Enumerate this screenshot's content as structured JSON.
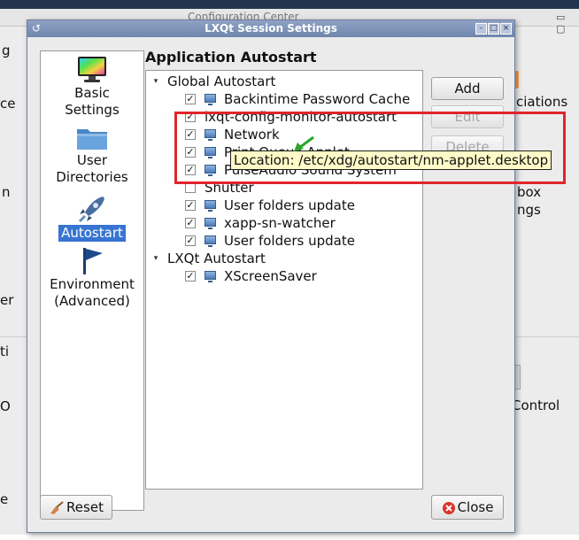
{
  "background_window": {
    "title": "Configuration Center",
    "fragments": {
      "left_g": "g",
      "left_ce": "ce",
      "left_n": "n",
      "left_er": "er",
      "left_ti": "ti",
      "left_oi": "O",
      "left_e": "e",
      "right_ciations": "ciations",
      "right_box": "box",
      "right_ngs": "ngs",
      "right_control": "Control"
    }
  },
  "dialog": {
    "title": "LXQt Session Settings",
    "sidebar": [
      {
        "id": "basic",
        "label_line1": "Basic",
        "label_line2": "Settings",
        "icon": "monitor-icon"
      },
      {
        "id": "dirs",
        "label_line1": "User",
        "label_line2": "Directories",
        "icon": "folder-icon"
      },
      {
        "id": "autostart",
        "label_line1": "Autostart",
        "label_line2": "",
        "icon": "rocket-icon",
        "selected": true
      },
      {
        "id": "env",
        "label_line1": "Environment",
        "label_line2": "(Advanced)",
        "icon": "flag-icon"
      }
    ],
    "heading": "Application Autostart",
    "tree": {
      "groups": [
        {
          "label": "Global Autostart",
          "items": [
            {
              "label": "Backintime Password Cache",
              "checked": true
            },
            {
              "label": "lxqt-config-monitor-autostart",
              "checked": true
            },
            {
              "label": "Network",
              "checked": true
            },
            {
              "label": "Print Queue Applet",
              "checked": true
            },
            {
              "label": "PulseAudio Sound System",
              "checked": true
            },
            {
              "label": "Shutter",
              "checked": false
            },
            {
              "label": "User folders update",
              "checked": true
            },
            {
              "label": "xapp-sn-watcher",
              "checked": true
            },
            {
              "label": "User folders update",
              "checked": true
            }
          ]
        },
        {
          "label": "LXQt Autostart",
          "items": [
            {
              "label": "XScreenSaver",
              "checked": true
            }
          ]
        }
      ]
    },
    "buttons": {
      "add": "Add",
      "edit": "Edit",
      "delete": "Delete",
      "reset": "Reset",
      "close": "Close"
    },
    "tooltip": "Location: /etc/xdg/autostart/nm-applet.desktop"
  },
  "colors": {
    "highlight_box": "#e0252b",
    "arrow": "#2aa52a",
    "selection": "#3874d1",
    "tooltip_bg": "#fffac8"
  }
}
